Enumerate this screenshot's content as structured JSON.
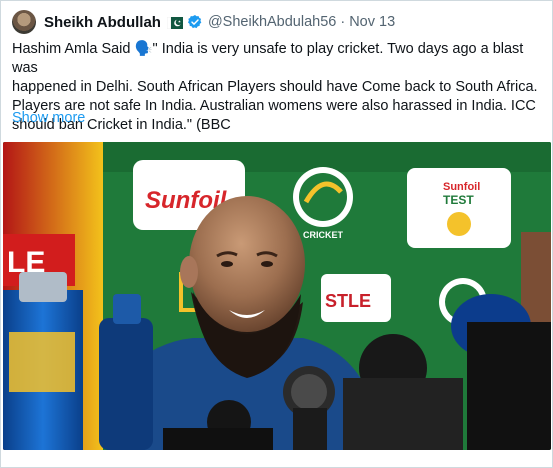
{
  "tweet": {
    "author": {
      "name": "Sheikh Abdullah",
      "handle": "@SheikhAbdulah56",
      "verified": true,
      "flag_icon": "pakistan-flag-icon"
    },
    "separator": "·",
    "date": "Nov 13",
    "text_lines": [
      "Hashim Amla Said 🗣️\" India is very unsafe to play cricket. Two days ago a blast was",
      "happened in Delhi. South African Players should have Come back to South Africa.",
      "Players are not safe In India. Australian womens were also harassed in India. ICC",
      "should ban Cricket in India.\" (BBC"
    ],
    "show_more": "Show more",
    "media": {
      "icon": "press-conference-photo",
      "banner_texts": {
        "sunfoil": "Sunfoil",
        "sunfoil_test_top": "Sunfoil",
        "sunfoil_test_bottom": "TEST",
        "le": "LE",
        "stle": "STLE",
        "cricket": "CRICKET"
      }
    }
  },
  "colors": {
    "link": "#1d9bf0",
    "secondary_text": "#536471",
    "verified": "#1d9bf0",
    "backdrop_green": "#1f7a3a"
  }
}
